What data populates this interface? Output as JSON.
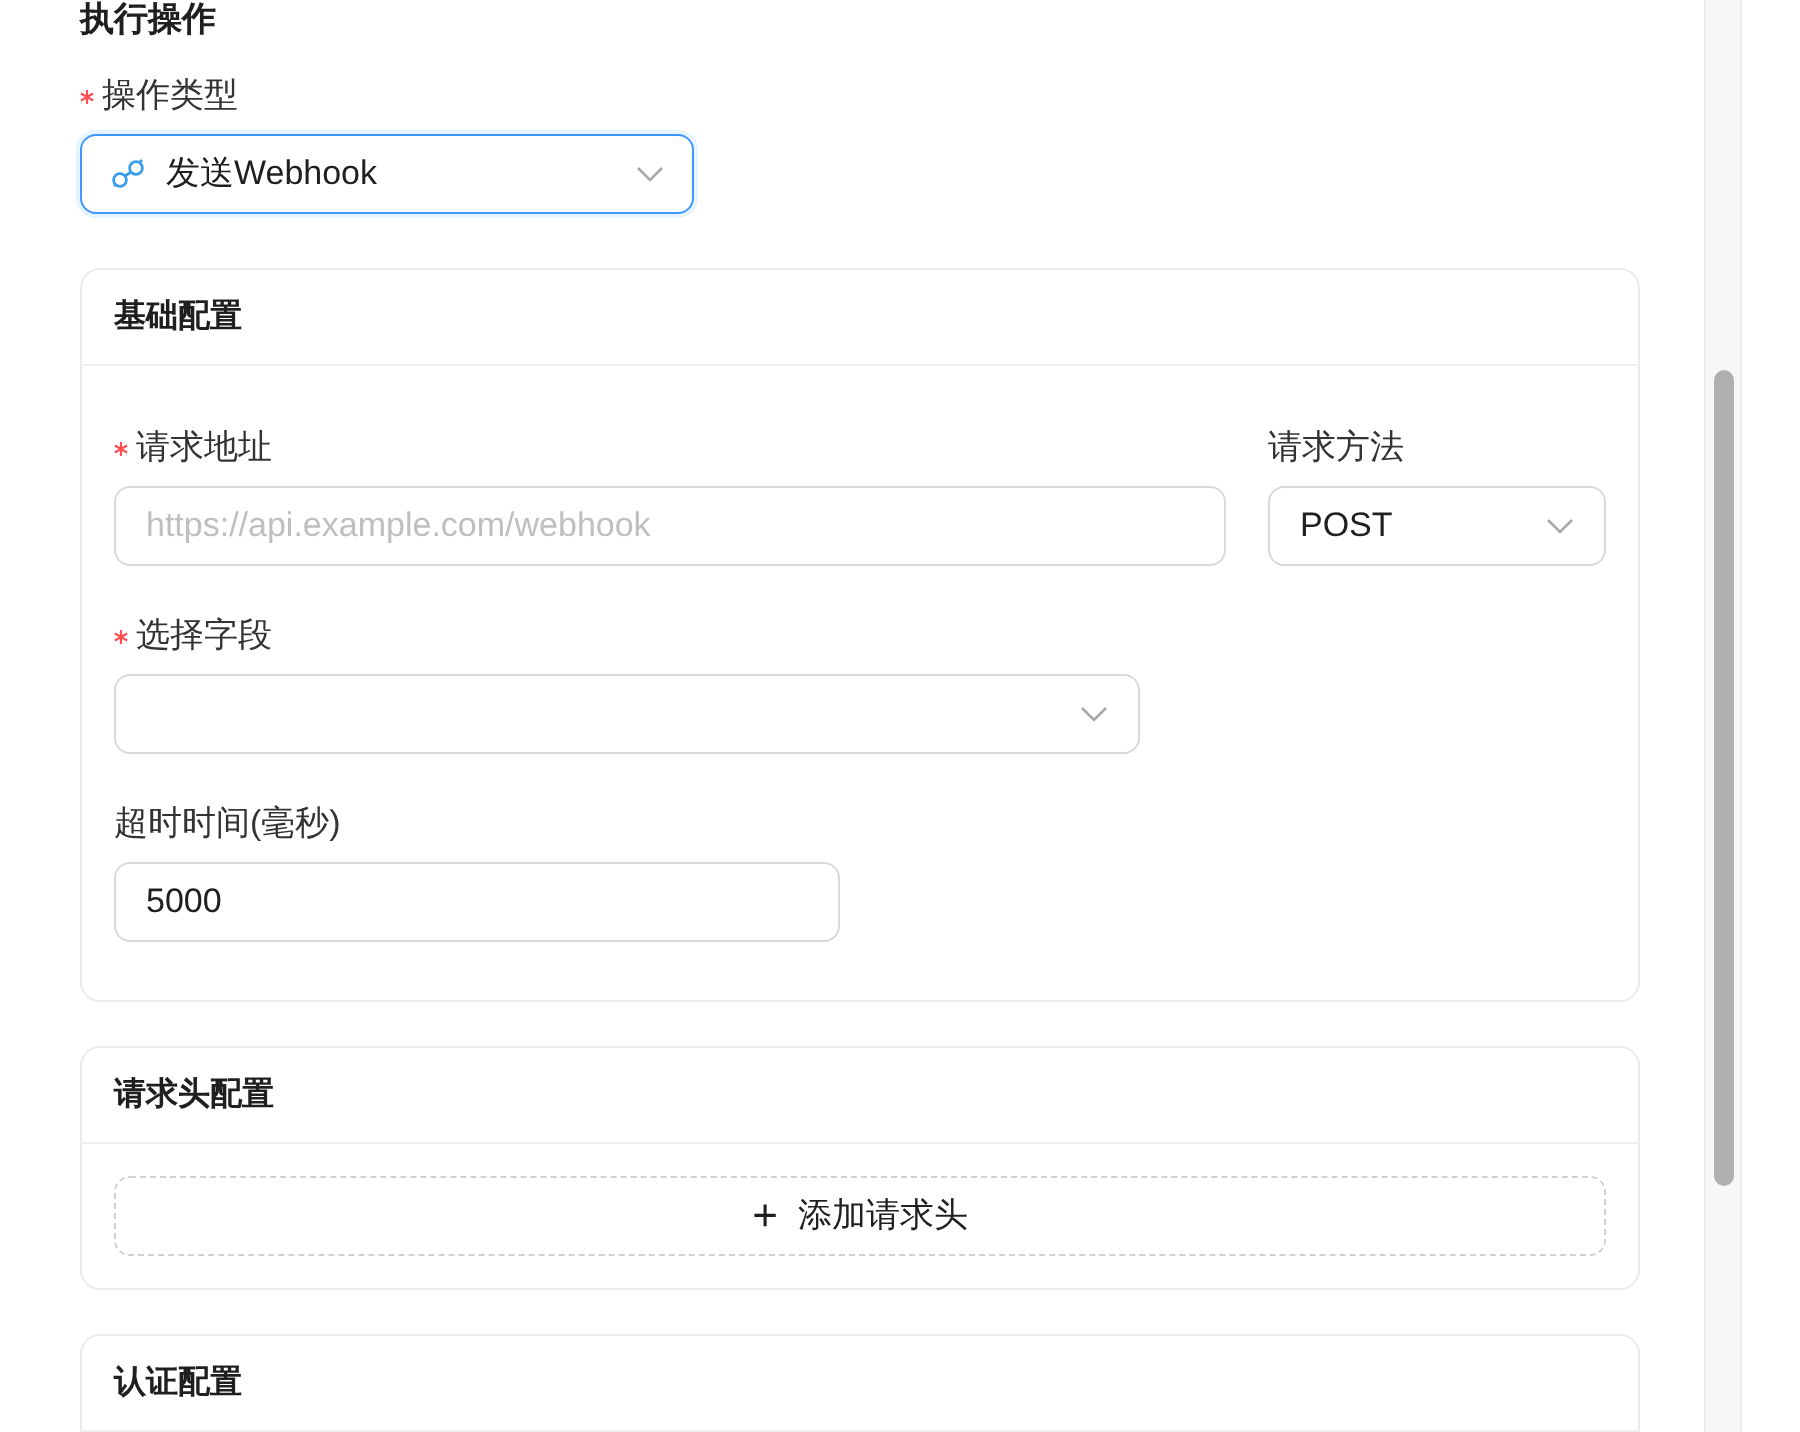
{
  "section_title": "执行操作",
  "action_type": {
    "label": "操作类型",
    "required": true,
    "value": "发送Webhook",
    "focused": true
  },
  "cards": [
    {
      "title": "基础配置",
      "kind": "basic",
      "url": {
        "label": "请求地址",
        "required": true,
        "placeholder": "https://api.example.com/webhook"
      },
      "method": {
        "label": "请求方法",
        "required": false,
        "value": "POST"
      },
      "fields": {
        "label": "选择字段",
        "required": true
      },
      "timeout": {
        "label": "超时时间(毫秒)",
        "required": false,
        "value": "5000"
      }
    },
    {
      "title": "请求头配置",
      "kind": "headers",
      "add_button": {
        "icon": "+",
        "label": "添加请求头"
      }
    },
    {
      "title": "认证配置",
      "kind": "auth"
    }
  ]
}
